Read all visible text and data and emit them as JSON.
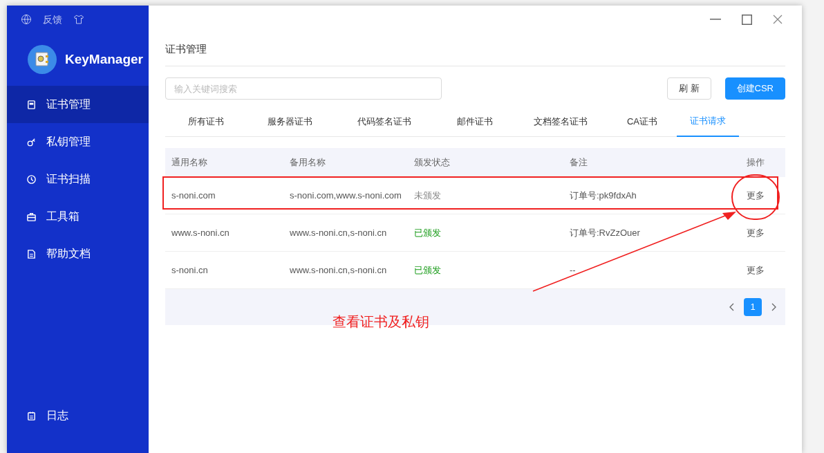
{
  "sidebar": {
    "top_links": [
      {
        "kind": "globe"
      },
      {
        "kind": "text",
        "label": "反馈"
      },
      {
        "kind": "shirt"
      }
    ],
    "app_name": "KeyManager",
    "items": [
      {
        "label": "证书管理",
        "selected": true
      },
      {
        "label": "私钥管理",
        "selected": false
      },
      {
        "label": "证书扫描",
        "selected": false
      },
      {
        "label": "工具箱",
        "selected": false
      },
      {
        "label": "帮助文档",
        "selected": false
      }
    ],
    "bottom_items": [
      {
        "label": "日志",
        "selected": false
      }
    ]
  },
  "page_title": "证书管理",
  "search": {
    "placeholder": "输入关键词搜索"
  },
  "buttons": [
    {
      "label": "刷 新",
      "kind": "default"
    },
    {
      "label": "创建CSR",
      "kind": "primary"
    }
  ],
  "tabs": [
    {
      "label": "所有证书",
      "selected": false
    },
    {
      "label": "服务器证书",
      "selected": false
    },
    {
      "label": "代码签名证书",
      "selected": false
    },
    {
      "label": "邮件证书",
      "selected": false
    },
    {
      "label": "文档签名证书",
      "selected": false
    },
    {
      "label": "CA证书",
      "selected": false
    },
    {
      "label": "证书请求",
      "selected": true
    }
  ],
  "table": {
    "columns": [
      "通用名称",
      "备用名称",
      "颁发状态",
      "备注",
      "操作"
    ],
    "rows": [
      {
        "common_name": "s-noni.com",
        "alt_names": "s-noni.com,www.s-noni.com",
        "status": "未颁发",
        "issued": false,
        "note": "订单号:pk9fdxAh",
        "action": "更多",
        "highlighted": true
      },
      {
        "common_name": "www.s-noni.cn",
        "alt_names": "www.s-noni.cn,s-noni.cn",
        "status": "已颁发",
        "issued": true,
        "note": "订单号:RvZzOuer",
        "action": "更多",
        "highlighted": false
      },
      {
        "common_name": "s-noni.cn",
        "alt_names": "www.s-noni.cn,s-noni.cn",
        "status": "已颁发",
        "issued": true,
        "note": "--",
        "action": "更多",
        "highlighted": false
      }
    ]
  },
  "pagination": {
    "pages": [
      {
        "label": "1",
        "selected": true
      }
    ]
  },
  "annotation": {
    "text": "查看证书及私钥"
  }
}
